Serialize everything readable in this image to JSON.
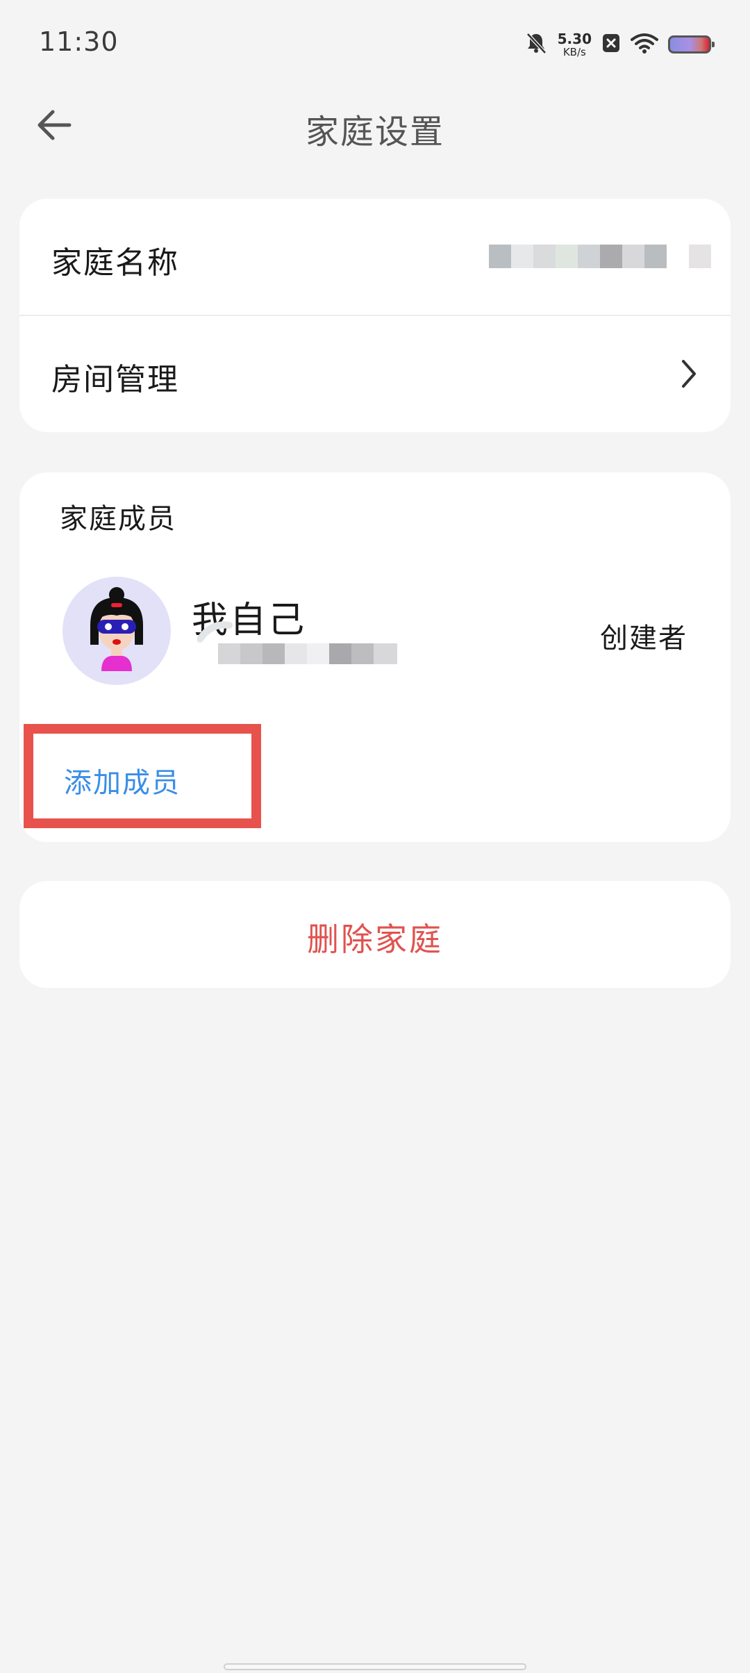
{
  "status_bar": {
    "time": "11:30",
    "net_speed_value": "5.30",
    "net_speed_unit": "KB/s",
    "icons": [
      "mute-bell-icon",
      "close-box-icon",
      "wifi-icon",
      "battery-icon"
    ]
  },
  "header": {
    "title": "家庭设置",
    "back_icon": "arrow-left-icon"
  },
  "family_info": {
    "name_label": "家庭名称",
    "room_label": "房间管理",
    "chevron_icon": "chevron-right-icon"
  },
  "members": {
    "section_title": "家庭成员",
    "items": [
      {
        "name": "我自己",
        "role": "创建者"
      }
    ],
    "add_label": "添加成员"
  },
  "actions": {
    "delete_label": "删除家庭"
  },
  "colors": {
    "background": "#f4f4f4",
    "card": "#ffffff",
    "link_blue": "#3a8ee6",
    "danger_red": "#e0534f",
    "highlight_box": "#e8524d"
  }
}
